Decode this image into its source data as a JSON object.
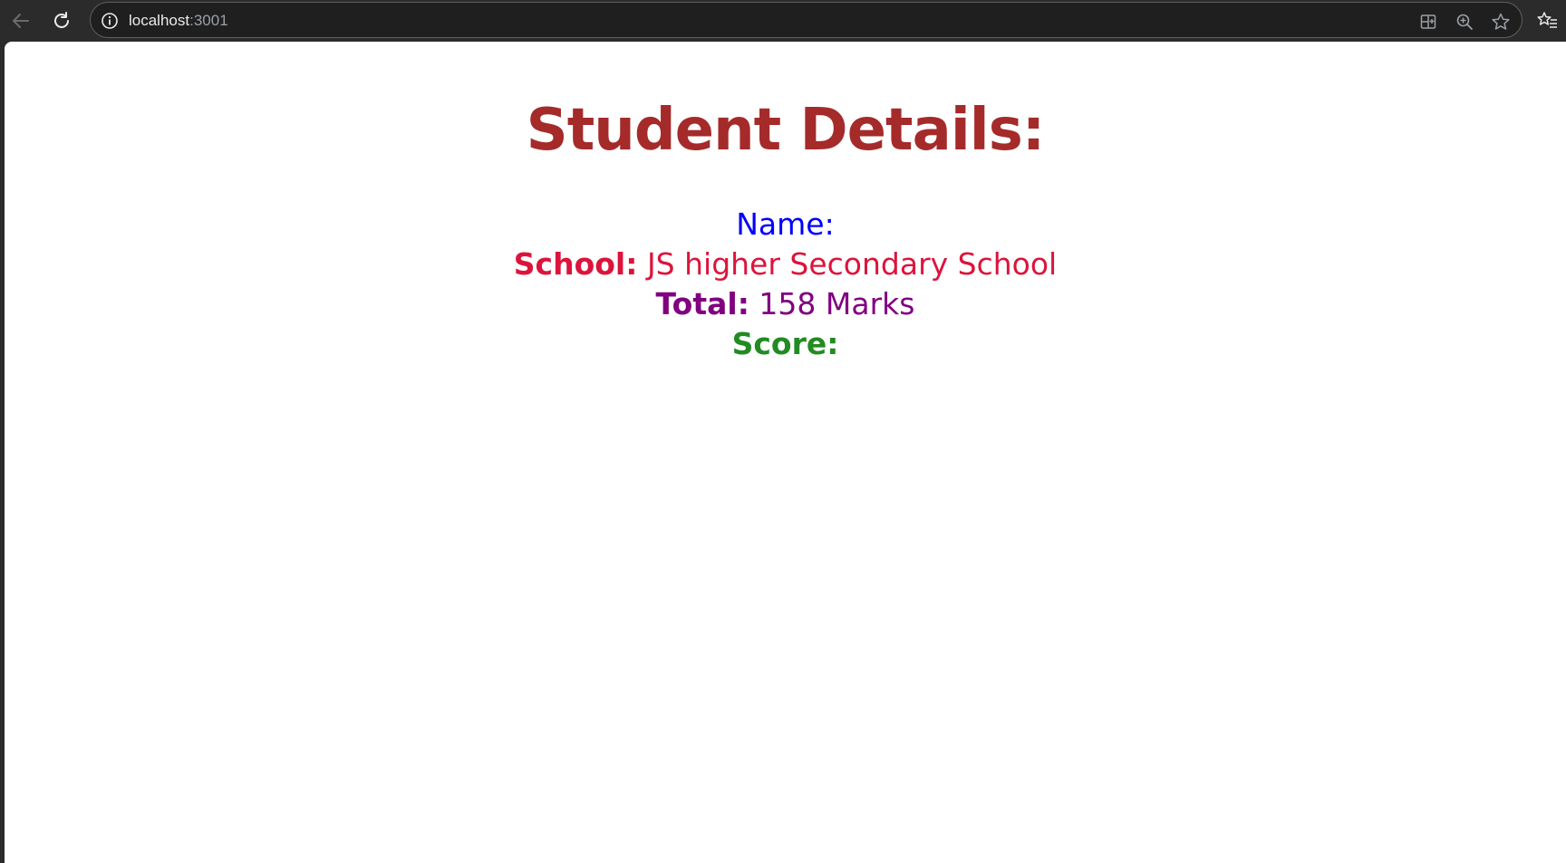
{
  "browser": {
    "url_host": "localhost",
    "url_port": ":3001",
    "icons": {
      "back": "arrow-left",
      "reload": "reload",
      "site_info": "info-circle",
      "split_screen": "split-screen",
      "zoom": "zoom-in",
      "favorite": "star-outline",
      "favorites_menu": "favorites-list"
    },
    "colors": {
      "chrome_bg": "#2b2b2b",
      "address_bg": "#1f1f1f"
    }
  },
  "page": {
    "title": "Student Details:",
    "title_color": "#a52a2a",
    "rows": {
      "name": {
        "label": "Name:",
        "value": "",
        "color": "#0000ff"
      },
      "school": {
        "label": "School:",
        "value": "JS higher Secondary School",
        "color": "#dc143c"
      },
      "total": {
        "label": "Total:",
        "value": "158 Marks",
        "color": "#800080"
      },
      "score": {
        "label": "Score:",
        "value": "",
        "color": "#228b22"
      }
    }
  }
}
